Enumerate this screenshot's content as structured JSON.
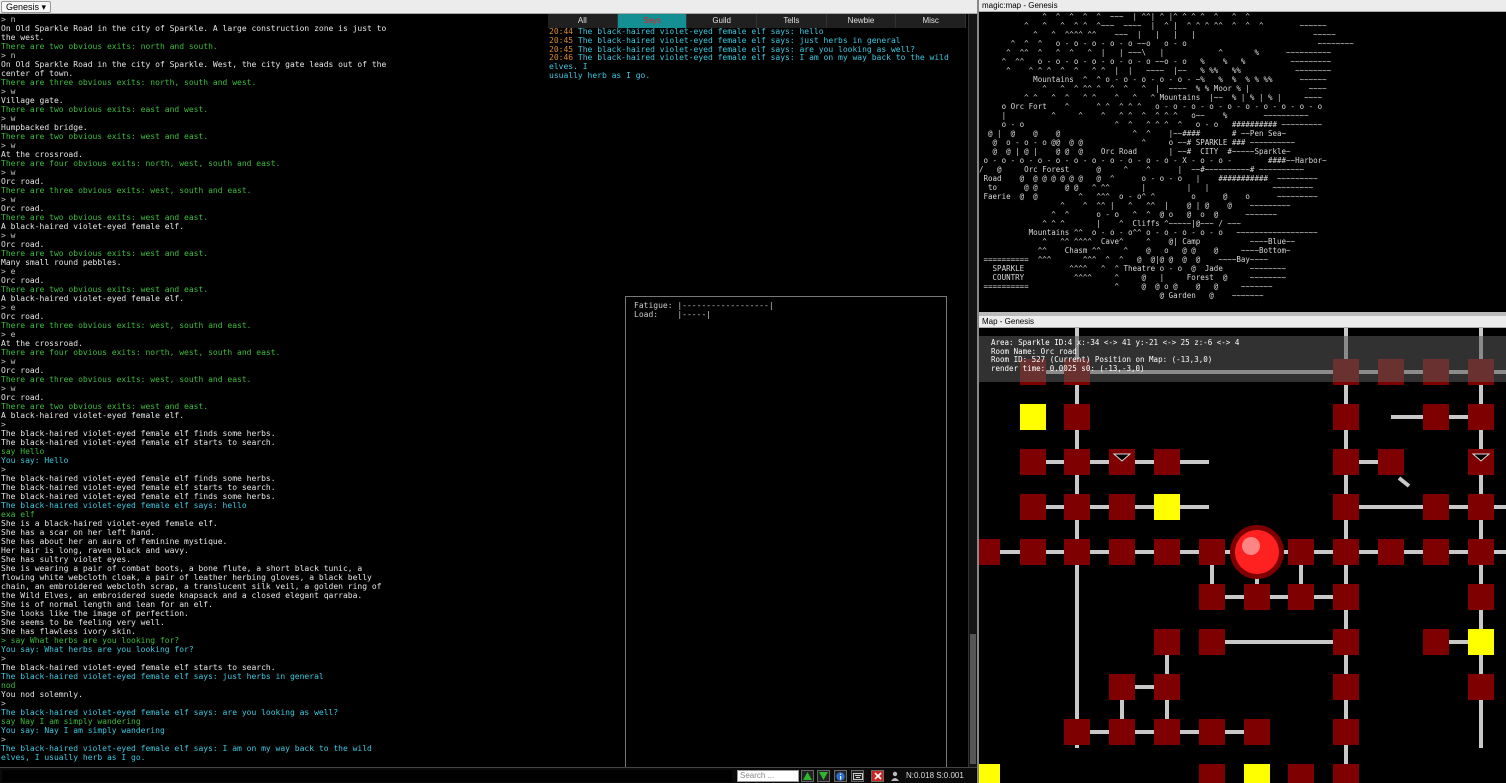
{
  "topbar": {
    "profile_label": "Genesis ▾"
  },
  "output": [
    {
      "t": "> n",
      "c": "c-gray"
    },
    {
      "t": "On Old Sparkle Road in the city of Sparkle. A large construction zone is just to",
      "c": "c-white"
    },
    {
      "t": "the west.",
      "c": "c-white"
    },
    {
      "t": "There are two obvious exits: north and south.",
      "c": "c-green"
    },
    {
      "t": "> n",
      "c": "c-gray"
    },
    {
      "t": "On Old Sparkle Road in the city of Sparkle. West, the city gate leads out of the",
      "c": "c-white"
    },
    {
      "t": "center of town.",
      "c": "c-white"
    },
    {
      "t": "There are three obvious exits: north, south and west.",
      "c": "c-green"
    },
    {
      "t": "> w",
      "c": "c-gray"
    },
    {
      "t": "Village gate.",
      "c": "c-white"
    },
    {
      "t": "There are two obvious exits: east and west.",
      "c": "c-green"
    },
    {
      "t": "> w",
      "c": "c-gray"
    },
    {
      "t": "Humpbacked bridge.",
      "c": "c-white"
    },
    {
      "t": "There are two obvious exits: west and east.",
      "c": "c-green"
    },
    {
      "t": "> w",
      "c": "c-gray"
    },
    {
      "t": "At the crossroad.",
      "c": "c-white"
    },
    {
      "t": "There are four obvious exits: north, west, south and east.",
      "c": "c-green"
    },
    {
      "t": "> w",
      "c": "c-gray"
    },
    {
      "t": "Orc road.",
      "c": "c-white"
    },
    {
      "t": "There are three obvious exits: west, south and east.",
      "c": "c-green"
    },
    {
      "t": "> w",
      "c": "c-gray"
    },
    {
      "t": "Orc road.",
      "c": "c-white"
    },
    {
      "t": "There are two obvious exits: west and east.",
      "c": "c-green"
    },
    {
      "t": "A black-haired violet-eyed female elf.",
      "c": "c-white"
    },
    {
      "t": "> w",
      "c": "c-gray"
    },
    {
      "t": "Orc road.",
      "c": "c-white"
    },
    {
      "t": "There are two obvious exits: west and east.",
      "c": "c-green"
    },
    {
      "t": "Many small round pebbles.",
      "c": "c-white"
    },
    {
      "t": "> e",
      "c": "c-gray"
    },
    {
      "t": "Orc road.",
      "c": "c-white"
    },
    {
      "t": "There are two obvious exits: west and east.",
      "c": "c-green"
    },
    {
      "t": "A black-haired violet-eyed female elf.",
      "c": "c-white"
    },
    {
      "t": "> e",
      "c": "c-gray"
    },
    {
      "t": "Orc road.",
      "c": "c-white"
    },
    {
      "t": "There are three obvious exits: west, south and east.",
      "c": "c-green"
    },
    {
      "t": "> e",
      "c": "c-gray"
    },
    {
      "t": "At the crossroad.",
      "c": "c-white"
    },
    {
      "t": "There are four obvious exits: north, west, south and east.",
      "c": "c-green"
    },
    {
      "t": "> w",
      "c": "c-gray"
    },
    {
      "t": "Orc road.",
      "c": "c-white"
    },
    {
      "t": "There are three obvious exits: west, south and east.",
      "c": "c-green"
    },
    {
      "t": "> w",
      "c": "c-gray"
    },
    {
      "t": "Orc road.",
      "c": "c-white"
    },
    {
      "t": "There are two obvious exits: west and east.",
      "c": "c-green"
    },
    {
      "t": "A black-haired violet-eyed female elf.",
      "c": "c-white"
    },
    {
      "t": ">",
      "c": "c-gray"
    },
    {
      "t": "The black-haired violet-eyed female elf finds some herbs.",
      "c": "c-white"
    },
    {
      "t": "The black-haired violet-eyed female elf starts to search.",
      "c": "c-white"
    },
    {
      "t": "say Hello",
      "c": "c-green"
    },
    {
      "t": "You say: Hello",
      "c": "c-cyan"
    },
    {
      "t": ">",
      "c": "c-gray"
    },
    {
      "t": "The black-haired violet-eyed female elf finds some herbs.",
      "c": "c-white"
    },
    {
      "t": "The black-haired violet-eyed female elf starts to search.",
      "c": "c-white"
    },
    {
      "t": "The black-haired violet-eyed female elf finds some herbs.",
      "c": "c-white"
    },
    {
      "t": "The black-haired violet-eyed female elf says: hello",
      "c": "c-cyan"
    },
    {
      "t": "exa elf",
      "c": "c-green"
    },
    {
      "t": "She is a black-haired violet-eyed female elf.",
      "c": "c-white"
    },
    {
      "t": "She has a scar on her left hand.",
      "c": "c-white"
    },
    {
      "t": "She has about her an aura of feminine mystique.",
      "c": "c-white"
    },
    {
      "t": "Her hair is long, raven black and wavy.",
      "c": "c-white"
    },
    {
      "t": "She has sultry violet eyes.",
      "c": "c-white"
    },
    {
      "t": "She is wearing a pair of combat boots, a bone flute, a short black tunic, a",
      "c": "c-white"
    },
    {
      "t": "flowing white webcloth cloak, a pair of leather herbing gloves, a black belly",
      "c": "c-white"
    },
    {
      "t": "chain, an embroidered webcloth scrap, a translucent silk veil, a golden ring of",
      "c": "c-white"
    },
    {
      "t": "the Wild Elves, an embroidered suede knapsack and a closed elegant qarraba.",
      "c": "c-white"
    },
    {
      "t": "She is of normal length and lean for an elf.",
      "c": "c-white"
    },
    {
      "t": "She looks like the image of perfection.",
      "c": "c-white"
    },
    {
      "t": "She seems to be feeling very well.",
      "c": "c-white"
    },
    {
      "t": "She has flawless ivory skin.",
      "c": "c-white"
    },
    {
      "t": "> say What herbs are you looking for?",
      "c": "c-green"
    },
    {
      "t": "You say: What herbs are you looking for?",
      "c": "c-cyan"
    },
    {
      "t": ">",
      "c": "c-gray"
    },
    {
      "t": "The black-haired violet-eyed female elf starts to search.",
      "c": "c-white"
    },
    {
      "t": "The black-haired violet-eyed female elf says: just herbs in general",
      "c": "c-cyan"
    },
    {
      "t": "nod",
      "c": "c-green"
    },
    {
      "t": "You nod solemnly.",
      "c": "c-white"
    },
    {
      "t": ">",
      "c": "c-gray"
    },
    {
      "t": "The black-haired violet-eyed female elf says: are you looking as well?",
      "c": "c-cyan"
    },
    {
      "t": "say Nay I am simply wandering",
      "c": "c-green"
    },
    {
      "t": "You say: Nay I am simply wandering",
      "c": "c-cyan"
    },
    {
      "t": ">",
      "c": "c-gray"
    },
    {
      "t": "The black-haired violet-eyed female elf says: I am on my way back to the wild",
      "c": "c-cyan"
    },
    {
      "t": "elves, I usually herb as I go.",
      "c": "c-cyan"
    }
  ],
  "chat": {
    "tabs": [
      "All",
      "Says",
      "Guild",
      "Tells",
      "Newbie",
      "Misc"
    ],
    "active_tab": 1,
    "entries": [
      {
        "time": "20:44",
        "text": "The black-haired violet-eyed female elf says: hello"
      },
      {
        "time": "20:45",
        "text": "The black-haired violet-eyed female elf says: just herbs in general"
      },
      {
        "time": "20:45",
        "text": "The black-haired violet-eyed female elf says: are you looking as well?"
      },
      {
        "time": "20:46",
        "text": "The black-haired violet-eyed female elf says: I am on my way back to the wild elves. I\nusually herb as I go."
      }
    ]
  },
  "status": {
    "fatigue_label": "Fatigue:",
    "fatigue_bar": "|------------------|",
    "load_label": "Load:",
    "load_bar": "|-----|"
  },
  "commandbar": {
    "input_value": "",
    "search_placeholder": "Search ...",
    "net_stats": "N:0.018 S:0.001"
  },
  "magicmap": {
    "title": "magic:map - Genesis",
    "ascii": "              ^  ^  ^  ^  ^  ~~~  | ^^| ^ |^ ^ ^ ^  ^   ^  ^\n          ^   ^   ^  ^ ^  ^~~~  ~~~~  |  ^ |  ^ ^ ^ ^^  ^  ^  ^        ~~~~~~\n            ^   ^  ^^^^ ^^    ~~~  |   |   |   |                          ~~~~~\n       ^  ^  ^   o - o - o - o - o ~~o   o - o                             ~~~~~~~~\n      ^  ^^  ^   ^  ^   ^  |   | ~~~\\   |            ^       %      ~~~~~~~~~~\n     ^  ^^   o - o - o - o - o - o - o ~~o - o   %    %   %          ~~~~~~~~~\n      ^    ^ ^ ^  ^  ^   ^ ^  |  |   ~~~~  |~~   % %%   %%            ~~~~~~~~\n            Mountains  ^  ^ o - o - o - o - o - ~%   %  %  % % %%      ~~~~~~\n              ^   ^  ^ ^^ ^  ^  ^   ^  |  ~~~~  % % Moor % |             ~~~~\n          ^ ^   ^  ^   ^ ^    ^   ^   ^ Mountains  |~~  % | % | % |     ~~~~\n     o Orc Fort    ^      ^ ^  ^ ^ ^   o - o - o - o - o - o - o - o - o - o\n     |          ^     ^    ^   ^ ^  ^  ^ ^ ^   o~~    %        ~~~~~~~~~~\n     o - o                    ^  ^   ^ ^ ^  ^   o - o   ########## ~~~~~~~~~\n  @ |  @    @    @                ^  ^    |~~####       # ~~Pen Sea~\n   @  o - o - o @@  @ @             ^     o ~~# SPARKLE ### ~~~~~~~~~~\n   @  @ | @ |    @ @  @    Orc Road       | ~~#  CITY  #~~~~~Sparkle~\n o - o - o - o - o - o - o - o - o - o - o - X - o - o -        ####~~Harbor~\n/   @     Orc Forest      @     ^    ^      |  ~~#~~~~~~~~~~# ~~~~~~~~~~\n Road    @  @ @ @ @ @ @   @  ^      o - o - o   |    ###########  ~~~~~~~~~\n  to      @ @      @ @   ^ ^^       |         |   |              ~~~~~~~~~\n Faerie  @  @         ^   ^^^  o - o^ ^        o      @    o      ~~~~~~~~~\n                  ^    ^  ^^ |   ^   ^^  |    @ | @    @    ~~~~~~~~~\n                ^  ^      o - o   ^  ^  @ o   @  o  @      ~~~~~~~\n              ^ ^ ^       |    ^  Cliffs ^~~~~~|@~~~ / ~~~\n           Mountains ^^  o - o - o^^ o - o - o - o - o   ~~~~~~~~~~~~~~~~~~\n              ^   ^^ ^^^^  Cave^     ^    @| Camp           ~~~~Blue~~\n             ^^    Chasm ^^     ^    @   o   @ @    @     ~~~~Bottom~\n ==========  ^^^       ^^^  ^  ^   @  @|@ @  @  @    ~~~~Bay~~~~\n   SPARKLE          ^^^^   ^  ^ Theatre o - o  @  Jade      ~~~~~~~~\n   COUNTRY           ^^^^     ^     @   |     Forest  @     ~~~~~~~~\n ==========                   ^     @  @ o @    @   @     ~~~~~~~\n                                        @ Garden   @    ~~~~~~~"
  },
  "mappane": {
    "title": "Map - Genesis",
    "area_line": "Area: Sparkle ID:4 x:-34 <-> 41 y:-21 <-> 25 z:-6 <-> 4",
    "room_name_line": "Room Name: Orc road",
    "room_id_line": "Room ID: 527 (Current) Position on Map: (-13,3,0)",
    "render_line": "render time: 0.0025 s0: (-13,-3,0)",
    "colors": {
      "room": "#7f0000",
      "special": "#ffff00",
      "path": "#c8c8c8",
      "player": "#ff2020"
    }
  }
}
